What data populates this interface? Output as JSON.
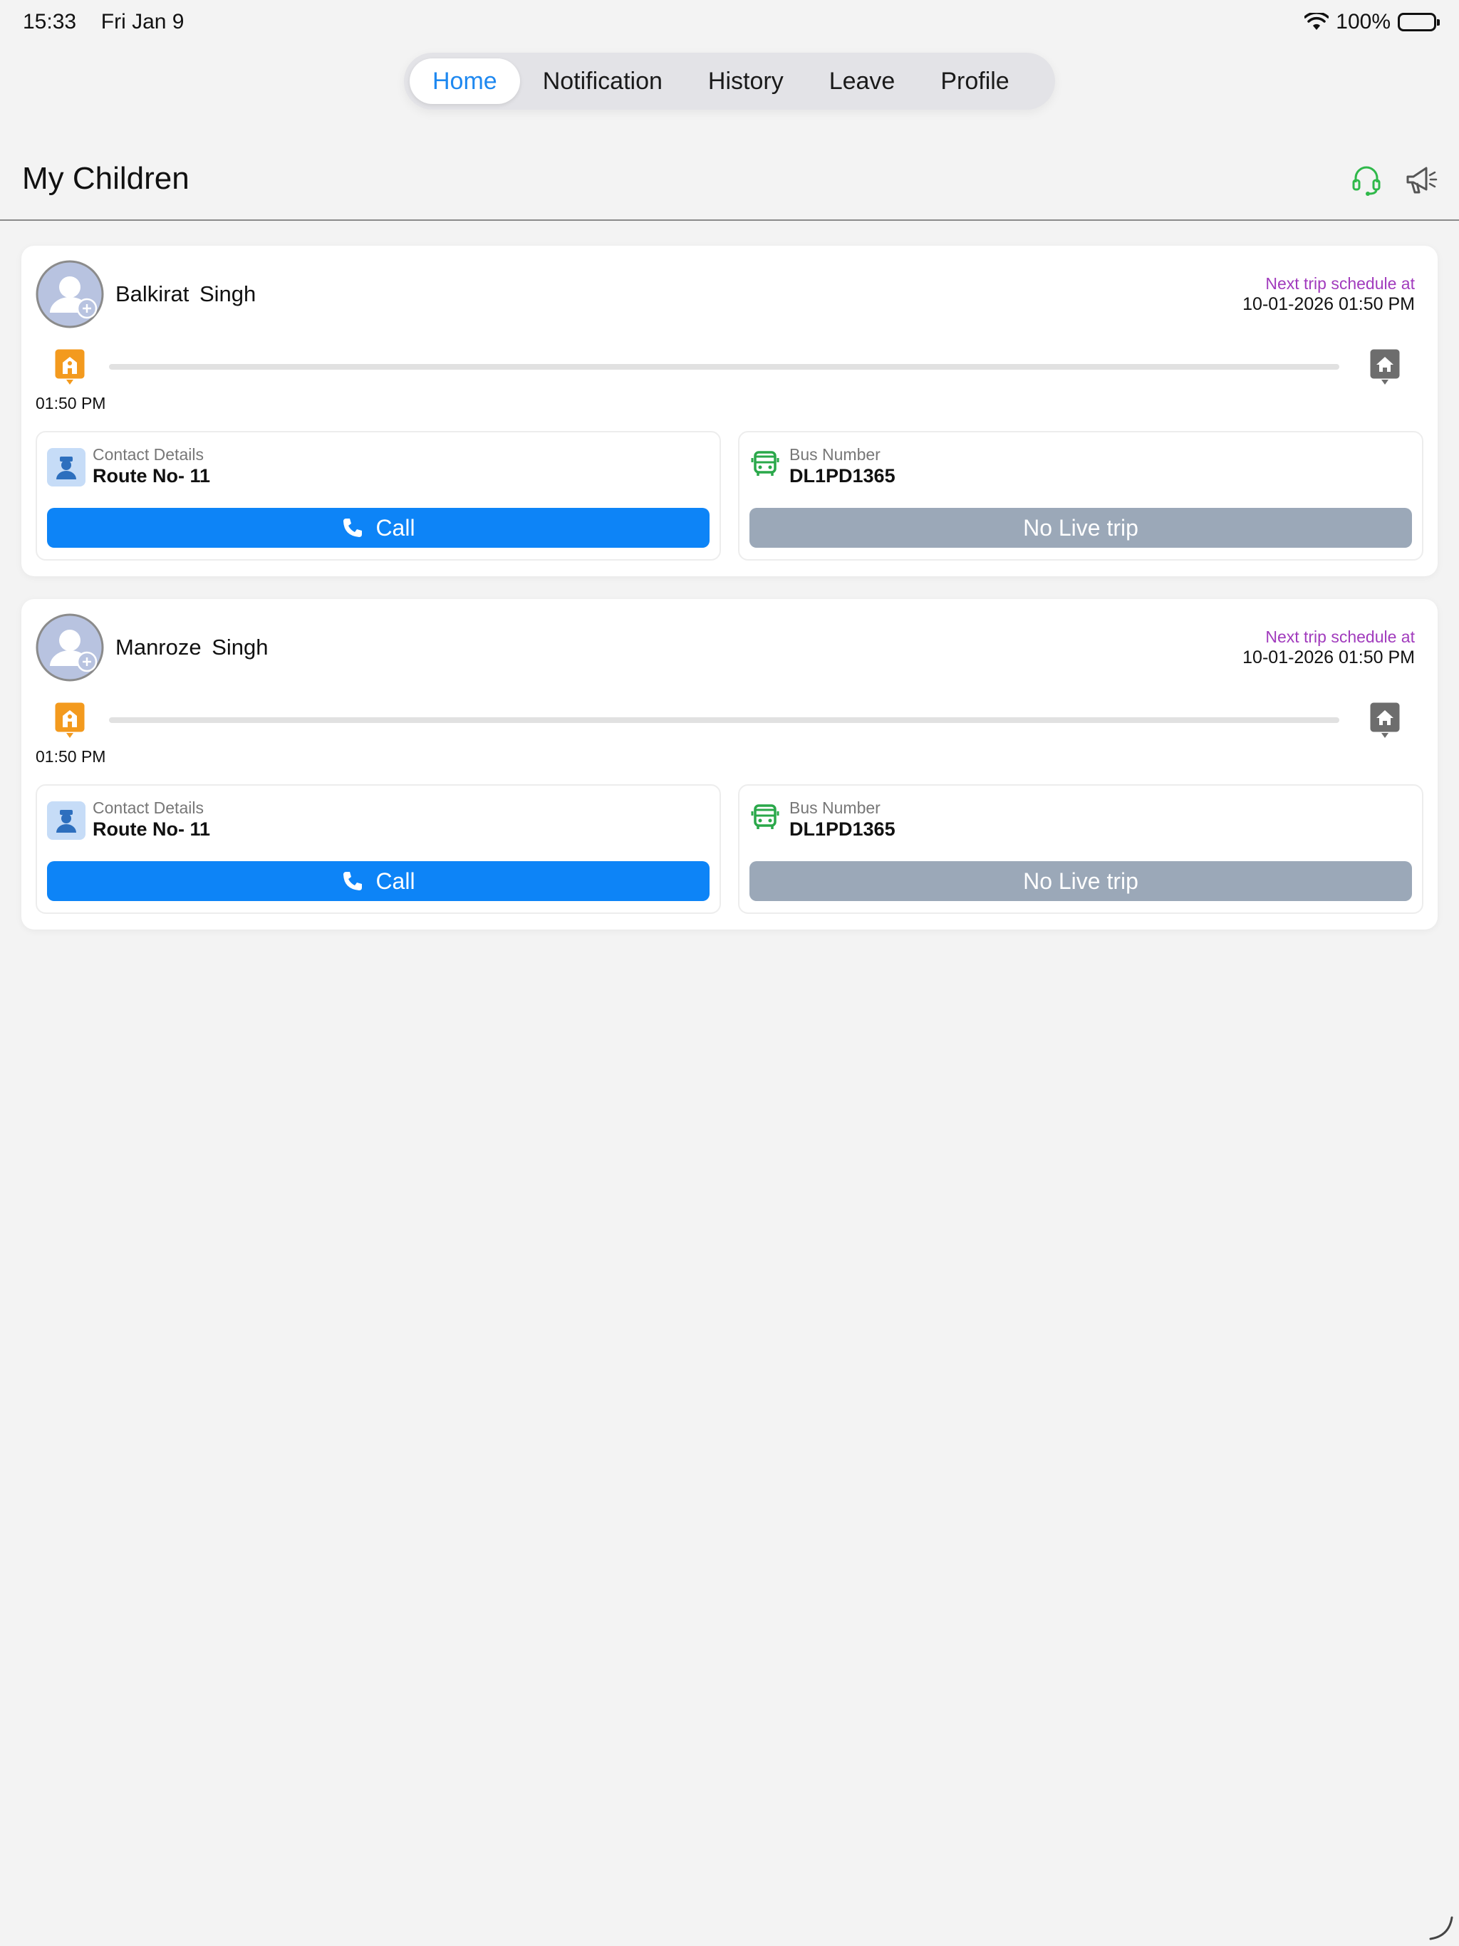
{
  "status_bar": {
    "time": "15:33",
    "date": "Fri Jan 9",
    "battery": "100%"
  },
  "tabs": [
    {
      "label": "Home",
      "active": true
    },
    {
      "label": "Notification",
      "active": false
    },
    {
      "label": "History",
      "active": false
    },
    {
      "label": "Leave",
      "active": false
    },
    {
      "label": "Profile",
      "active": false
    }
  ],
  "header": {
    "title": "My Children",
    "icons": [
      "headset-icon",
      "megaphone-icon"
    ]
  },
  "children": [
    {
      "name": "Balkirat  Singh",
      "next_trip_label": "Next trip schedule at",
      "next_trip_time": "10-01-2026 01:50 PM",
      "start_time": "01:50 PM",
      "contact_label": "Contact Details",
      "route": "Route No- 11",
      "call_label": "Call",
      "bus_label": "Bus Number",
      "bus_number": "DL1PD1365",
      "live_label": "No Live trip"
    },
    {
      "name": "Manroze  Singh",
      "next_trip_label": "Next trip schedule at",
      "next_trip_time": "10-01-2026 01:50 PM",
      "start_time": "01:50 PM",
      "contact_label": "Contact Details",
      "route": "Route No- 11",
      "call_label": "Call",
      "bus_label": "Bus Number",
      "bus_number": "DL1PD1365",
      "live_label": "No Live trip"
    }
  ],
  "colors": {
    "accent": "#1e88f0",
    "call_button": "#0d84f7",
    "disabled_button": "#9ba8b8",
    "trip_label": "#a13bbd",
    "school_marker": "#f39a1e",
    "home_marker": "#6d6d6d",
    "bus_icon": "#2aa84a",
    "headset_icon": "#2fb84a"
  }
}
